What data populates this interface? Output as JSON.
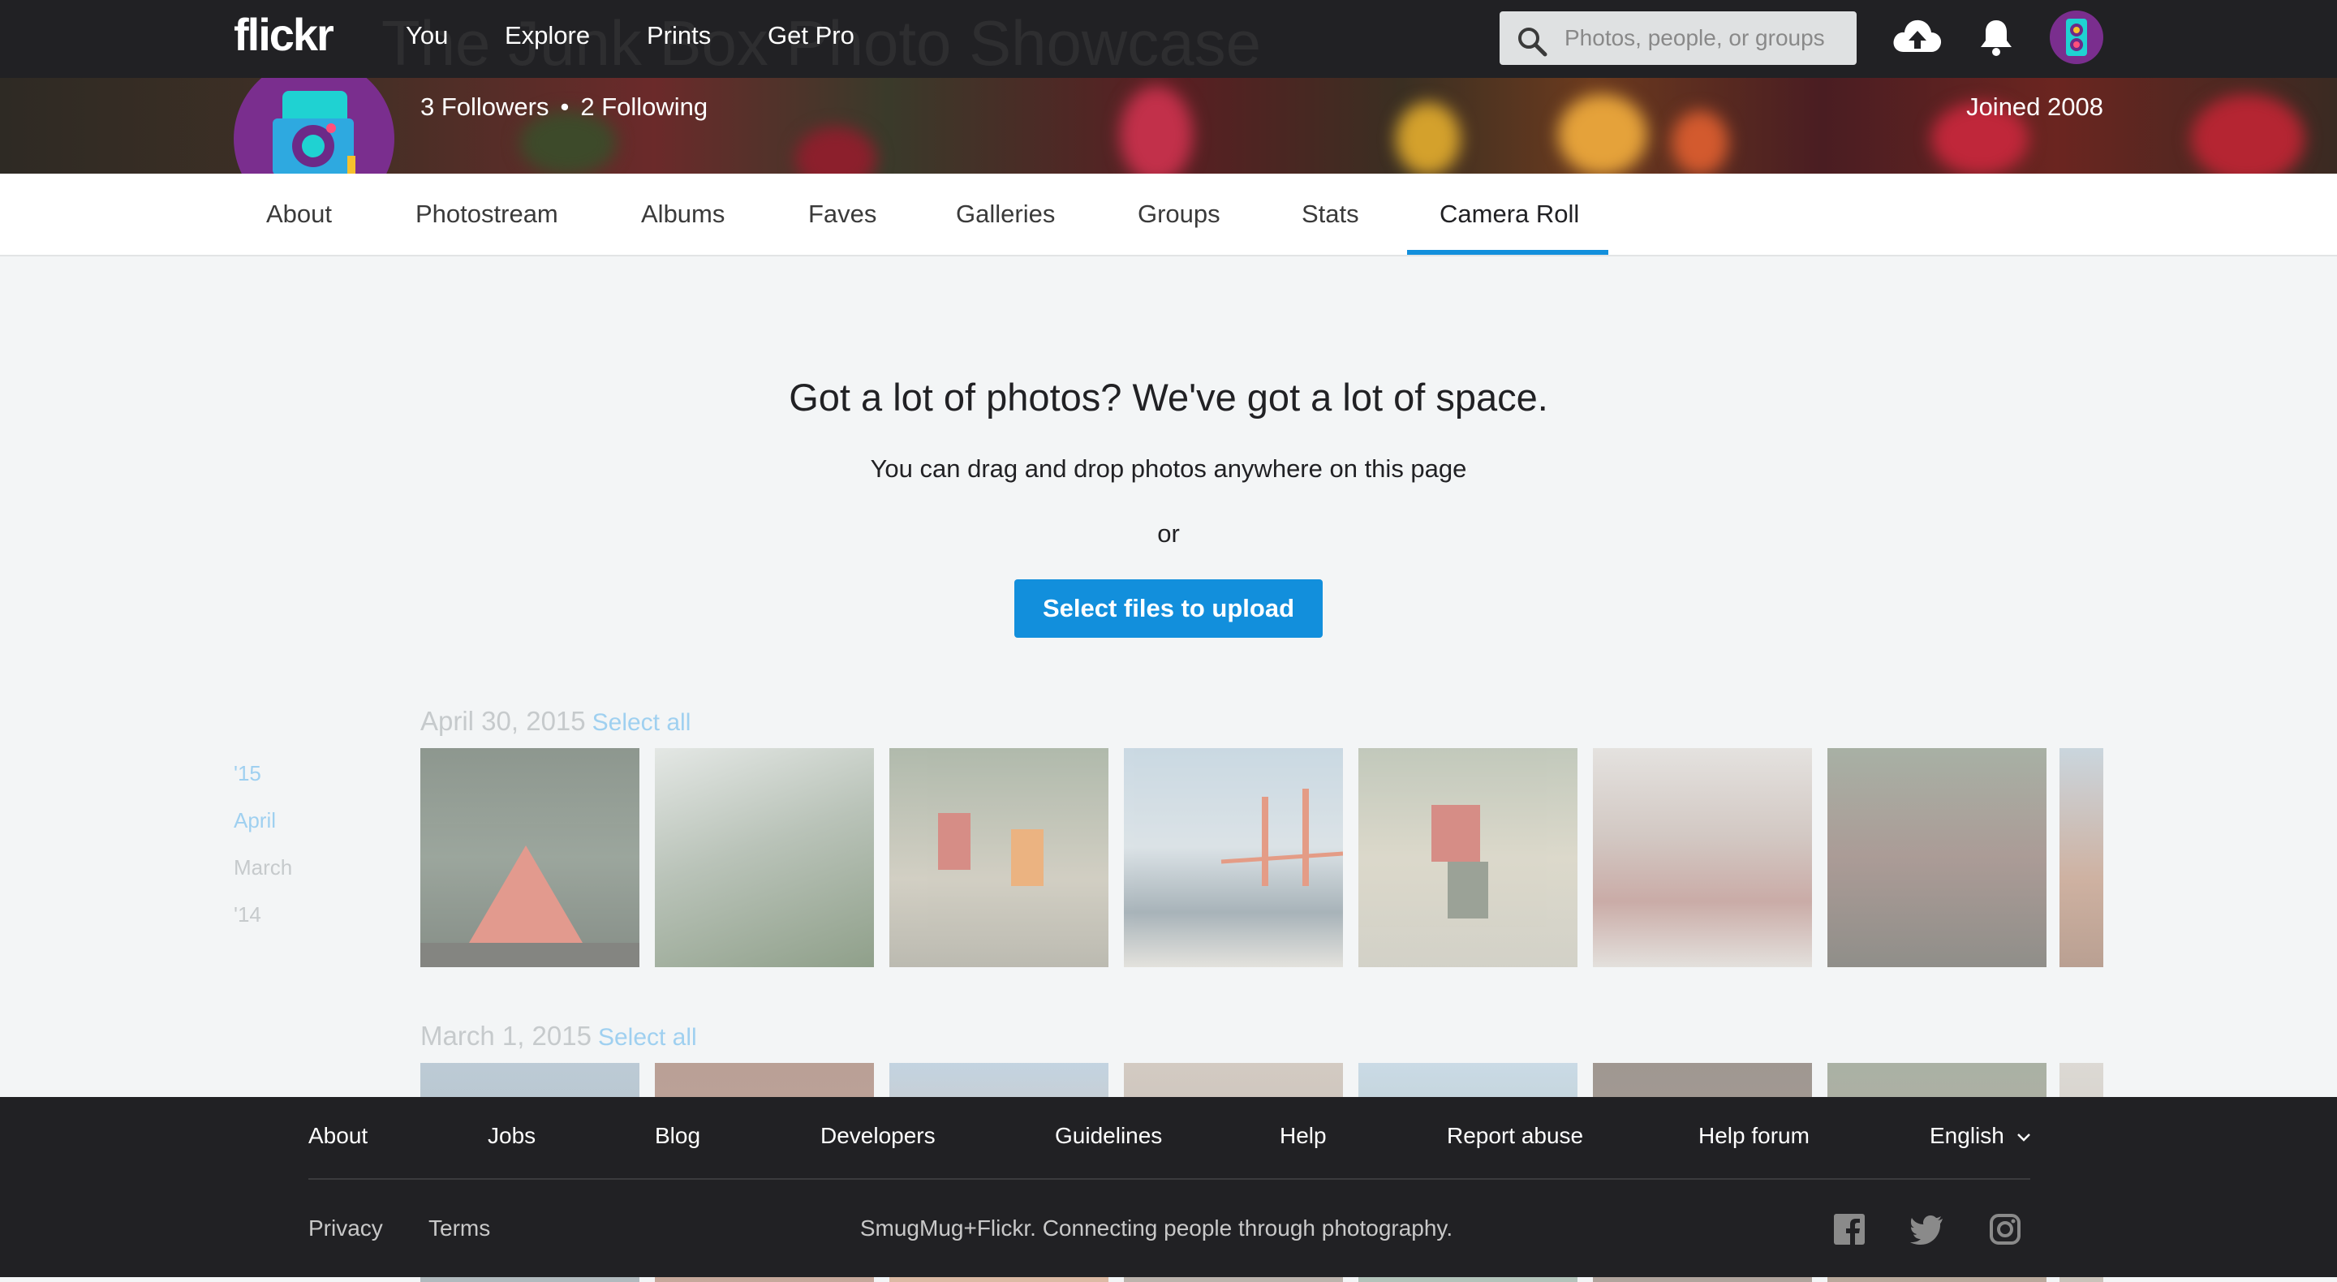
{
  "header": {
    "logo": "flickr",
    "ghost_title": "The Junk Box Photo Showcase",
    "nav": [
      "You",
      "Explore",
      "Prints",
      "Get Pro"
    ],
    "search_placeholder": "Photos, people, or groups",
    "icons": [
      "search-icon",
      "upload-cloud-icon",
      "bell-icon",
      "avatar"
    ]
  },
  "profile": {
    "followers": "3 Followers",
    "separator": "•",
    "following": "2 Following",
    "joined": "Joined 2008"
  },
  "tabs": [
    {
      "label": "About",
      "active": false
    },
    {
      "label": "Photostream",
      "active": false
    },
    {
      "label": "Albums",
      "active": false
    },
    {
      "label": "Faves",
      "active": false
    },
    {
      "label": "Galleries",
      "active": false
    },
    {
      "label": "Groups",
      "active": false
    },
    {
      "label": "Stats",
      "active": false
    },
    {
      "label": "Camera Roll",
      "active": true
    }
  ],
  "upload": {
    "title": "Got a lot of photos? We've got a lot of space.",
    "subtitle": "You can drag and drop photos anywhere on this page",
    "or": "or",
    "button": "Select files to upload"
  },
  "timeline": [
    "'15",
    "April",
    "March",
    "'14"
  ],
  "groups": [
    {
      "date": "April 30, 2015",
      "select_all": "Select all"
    },
    {
      "date": "March 1, 2015",
      "select_all": "Select all"
    }
  ],
  "footer": {
    "links": [
      "About",
      "Jobs",
      "Blog",
      "Developers",
      "Guidelines",
      "Help",
      "Report abuse",
      "Help forum"
    ],
    "language": "English",
    "privacy": "Privacy",
    "terms": "Terms",
    "tagline": "SmugMug+Flickr. Connecting people through photography.",
    "social": [
      "facebook-icon",
      "twitter-icon",
      "instagram-icon"
    ]
  },
  "colors": {
    "accent": "#128fdc",
    "nav_bg": "#212124",
    "page_bg": "#f3f5f6"
  }
}
